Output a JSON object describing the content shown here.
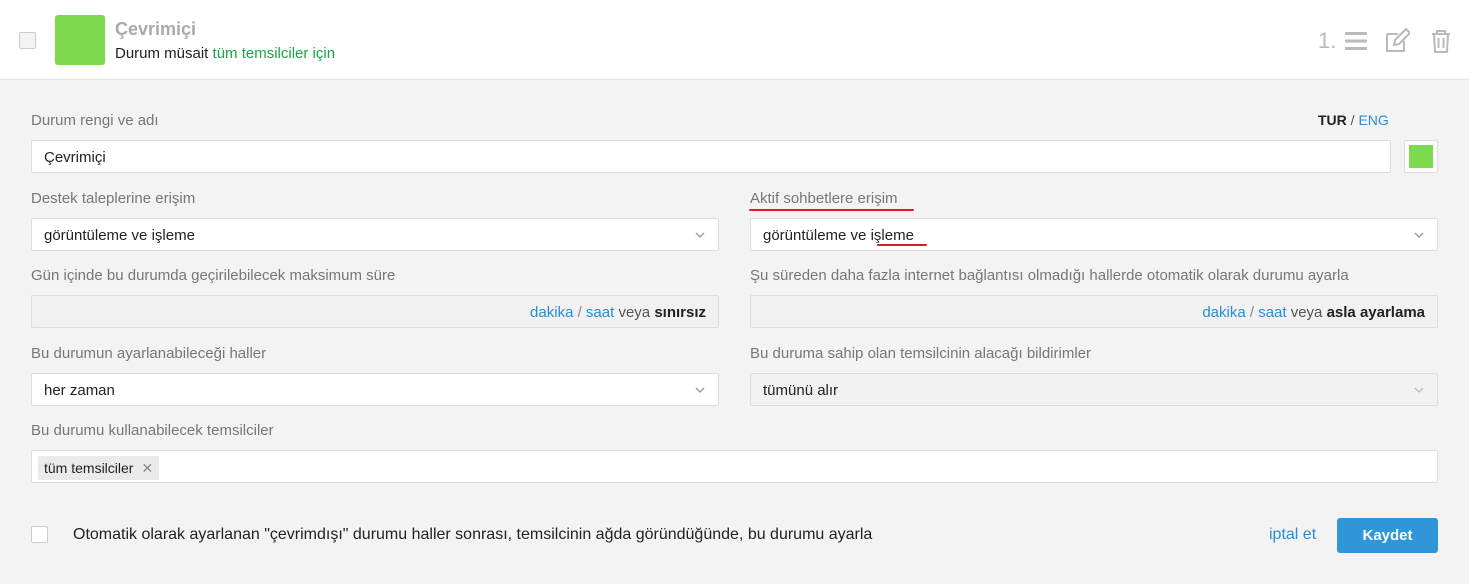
{
  "header": {
    "title": "Çevrimiçi",
    "subtitle_prefix": "Durum müsait",
    "subtitle_link": "tüm temsilciler için",
    "order": "1.",
    "status_color": "#7ed94f",
    "icons": [
      "list-icon",
      "edit-icon",
      "trash-icon"
    ]
  },
  "form": {
    "name_label": "Durum rengi ve adı",
    "lang_tur": "TUR",
    "lang_sep": "/",
    "lang_eng": "ENG",
    "name_value": "Çevrimiçi",
    "color": "#7ed94f",
    "tickets_label": "Destek taleplerine erişim",
    "tickets_value": "görüntüleme ve işleme",
    "chats_label": "Aktif sohbetlere erişim",
    "chats_value_prefix": "görüntüleme ve ",
    "chats_value_word": "işleme",
    "max_time_label": "Gün içinde bu durumda geçirilebilecek maksimum süre",
    "max_time_units": {
      "minutes": "dakika",
      "slash": "/",
      "hours": "saat",
      "or": "veya",
      "default": "sınırsız"
    },
    "offline_label": "Şu süreden daha fazla internet bağlantısı olmadığı hallerde otomatik olarak durumu ayarla",
    "offline_units": {
      "minutes": "dakika",
      "slash": "/",
      "hours": "saat",
      "or": "veya",
      "default": "asla ayarlama"
    },
    "when_label": "Bu durumun ayarlanabileceği haller",
    "when_value": "her zaman",
    "notify_label": "Bu duruma sahip olan temsilcinin alacağı bildirimler",
    "notify_value": "tümünü alır",
    "agents_label": "Bu durumu kullanabilecek temsilciler",
    "agents_tag": "tüm temsilciler",
    "agents_tag_remove": "✕"
  },
  "footer": {
    "auto_text": "Otomatik olarak ayarlanan \"çevrimdışı\" durumu haller sonrası, temsilcinin ağda göründüğünde, bu durumu ayarla",
    "cancel_label": "iptal et",
    "save_label": "Kaydet"
  },
  "colors": {
    "accent": "#2f97d8",
    "link": "#2a8dd4",
    "green_link": "#1aa34a",
    "underline": "#e0192a"
  }
}
